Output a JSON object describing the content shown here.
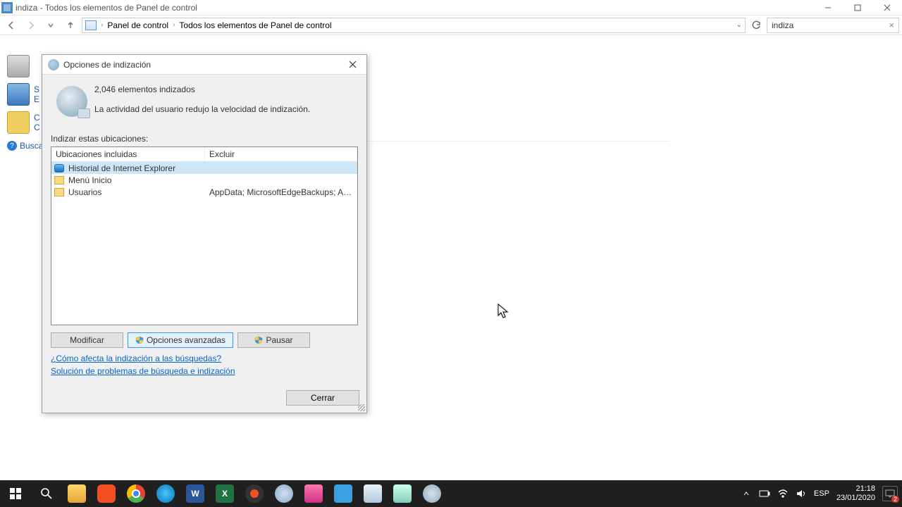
{
  "window": {
    "title": "indiza - Todos los elementos de Panel de control",
    "breadcrumb": {
      "root": "Panel de control",
      "current": "Todos los elementos de Panel de control"
    },
    "search_value": "indiza"
  },
  "cp": {
    "item1_prefix": "S",
    "item1_line2": "E",
    "item2_prefix": "C",
    "item2_line2": "C",
    "help": "Buscar"
  },
  "dialog": {
    "title": "Opciones de indización",
    "count": "2,046 elementos indizados",
    "status": "La actividad del usuario redujo la velocidad de indización.",
    "section_label": "Indizar estas ubicaciones:",
    "col_included": "Ubicaciones incluidas",
    "col_exclude": "Excluir",
    "rows": [
      {
        "name": "Historial de Internet Explorer",
        "exclude": ""
      },
      {
        "name": "Menú Inicio",
        "exclude": ""
      },
      {
        "name": "Usuarios",
        "exclude": "AppData; MicrosoftEdgeBackups; AppDat..."
      }
    ],
    "btn_modify": "Modificar",
    "btn_advanced": "Opciones avanzadas",
    "btn_pause": "Pausar",
    "link_how": "¿Cómo afecta la indización a las búsquedas?",
    "link_troubleshoot": "Solución de problemas de búsqueda e indización",
    "btn_close": "Cerrar"
  },
  "tray": {
    "lang": "ESP",
    "time": "21:18",
    "date": "23/01/2020",
    "notif_count": "2"
  }
}
